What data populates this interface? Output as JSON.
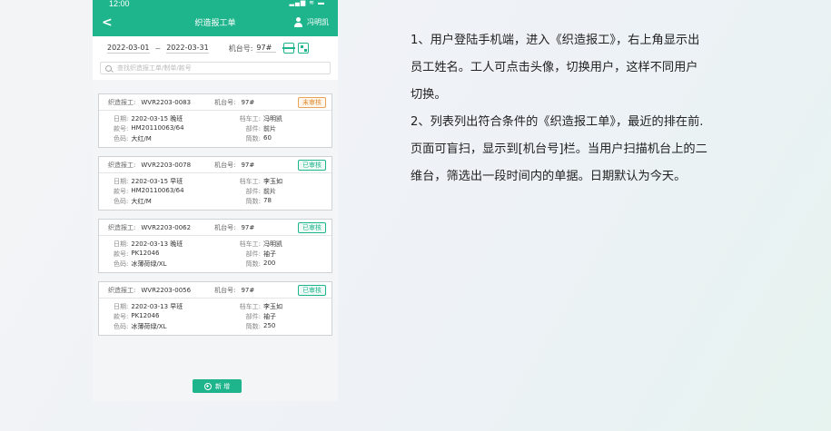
{
  "status_bar": {
    "time": "12:00",
    "icons": "▂▄▆ ≋ ▬"
  },
  "app_bar": {
    "back": "<",
    "title": "织造报工单",
    "user": "冯明凯"
  },
  "filter": {
    "date_from": "2022-03-01",
    "separator": "~",
    "date_to": "2022-03-31",
    "machine_label": "机台号:",
    "machine_value": "97#"
  },
  "search": {
    "placeholder": "查找织造报工单/制单/款号"
  },
  "labels": {
    "report": "织造报工:",
    "machine": "机台号:",
    "date": "日期:",
    "worker": "档车工:",
    "style": "款号:",
    "part": "部件:",
    "color": "色码:",
    "qty": "筒数:"
  },
  "cards": [
    {
      "no": "WVR2203-0083",
      "machine": "97#",
      "status": "未审核",
      "date": "2202-03-15 晚班",
      "worker": "冯明凯",
      "style": "HM20110063/64",
      "part": "前片",
      "color": "大红/M",
      "qty": "60"
    },
    {
      "no": "WVR2203-0078",
      "machine": "97#",
      "status": "已审核",
      "date": "2202-03-15 早班",
      "worker": "李玉如",
      "style": "HM20110063/64",
      "part": "前片",
      "color": "大红/M",
      "qty": "78"
    },
    {
      "no": "WVR2203-0062",
      "machine": "97#",
      "status": "已审核",
      "date": "2202-03-13 晚班",
      "worker": "冯明凯",
      "style": "PK12046",
      "part": "袖子",
      "color": "冰薄荷绿/XL",
      "qty": "200"
    },
    {
      "no": "WVR2203-0056",
      "machine": "97#",
      "status": "已审核",
      "date": "2202-03-13 早班",
      "worker": "李玉如",
      "style": "PK12046",
      "part": "袖子",
      "color": "冰薄荷绿/XL",
      "qty": "250"
    }
  ],
  "add_button": "新 增",
  "description": [
    "1、用户登陆手机端，进入《织造报工》，右上角显示出",
    "员工姓名。工人可点击头像，切换用户，这样不同用户",
    "切换。",
    "2、列表列出符合条件的《织造报工单》，最近的排在前.",
    "页面可盲扫，显示到[机台号]栏。当用户扫描机台上的二",
    "维台，筛选出一段时间内的单据。日期默认为今天。"
  ],
  "colors": {
    "accent": "#1fb58c",
    "pending": "#e08a2c"
  },
  "icons": [
    "back-icon",
    "user-icon",
    "scan-icon",
    "grid-icon",
    "search-icon",
    "plus-icon"
  ]
}
